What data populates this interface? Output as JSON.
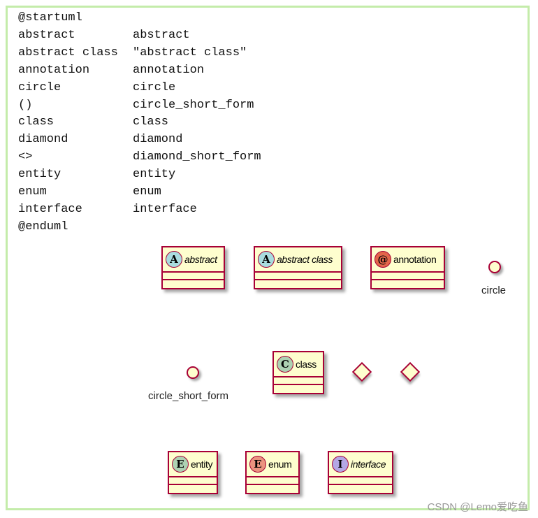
{
  "code": {
    "start": "@startuml",
    "end": "@enduml",
    "rows": [
      {
        "keyword": "abstract",
        "name": "abstract"
      },
      {
        "keyword": "abstract class",
        "name": "\"abstract class\""
      },
      {
        "keyword": "annotation",
        "name": "annotation"
      },
      {
        "keyword": "circle",
        "name": "circle"
      },
      {
        "keyword": "()",
        "name": "circle_short_form"
      },
      {
        "keyword": "class",
        "name": "class"
      },
      {
        "keyword": "diamond",
        "name": "diamond"
      },
      {
        "keyword": "<>",
        "name": "diamond_short_form"
      },
      {
        "keyword": "entity",
        "name": "entity"
      },
      {
        "keyword": "enum",
        "name": "enum"
      },
      {
        "keyword": "interface",
        "name": "interface"
      }
    ]
  },
  "diagram": {
    "colors": {
      "fill": "#fefece",
      "border": "#a80036"
    },
    "classes": {
      "abstract": {
        "letter": "A",
        "name": "abstract",
        "badge_color": "#a9dcdf"
      },
      "abstract_class": {
        "letter": "A",
        "name": "abstract class",
        "badge_color": "#a9dcdf"
      },
      "annotation": {
        "letter": "@",
        "name": "annotation",
        "badge_color": "#e3664a"
      },
      "class": {
        "letter": "C",
        "name": "class",
        "badge_color": "#add1b2"
      },
      "entity": {
        "letter": "E",
        "name": "entity",
        "badge_color": "#add1b2"
      },
      "enum": {
        "letter": "E",
        "name": "enum",
        "badge_color": "#eb937f"
      },
      "interface": {
        "letter": "I",
        "name": "interface",
        "badge_color": "#b4a7e5"
      }
    },
    "circle_label": "circle",
    "circle_short_label": "circle_short_form"
  },
  "watermark": "CSDN @Lemo爱吃鱼"
}
